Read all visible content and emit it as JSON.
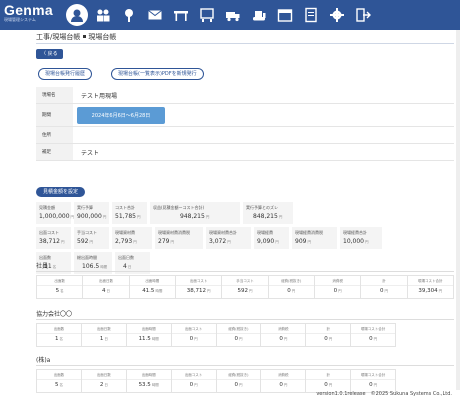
{
  "app": {
    "name": "Genma",
    "subtitle": "現場管理システム"
  },
  "nav": [
    "helmet-icon",
    "workers-icon",
    "location-pin-icon",
    "mail-icon",
    "trestle-icon",
    "site-board-icon",
    "truck-icon",
    "bulldozer-icon",
    "calendar-icon",
    "document-icon",
    "gear-icon",
    "exit-icon"
  ],
  "breadcrumb": {
    "parent": "工事/現場台帳",
    "current": "現場台帳"
  },
  "buttons": {
    "back": "〈 戻る",
    "history": "現場台帳発行履歴",
    "new_pdf": "現場台帳(一覧表示)PDFを新規発行",
    "budget": "見積金額を設定"
  },
  "form": {
    "site_name_label": "現場名",
    "site_name": "テスト用現場",
    "period_label": "期間",
    "period": "2024年6月6日〜6月28日",
    "address_label": "住所",
    "address": "",
    "note_label": "補足",
    "note": "テスト"
  },
  "summary": {
    "row1": [
      {
        "title": "見積金額",
        "value": "1,000,000",
        "unit": "円"
      },
      {
        "title": "実行予算",
        "value": "900,000",
        "unit": "円"
      },
      {
        "title": "コスト合計",
        "value": "51,785",
        "unit": "円"
      },
      {
        "title": "収益(見積金額ーコスト合計)",
        "value": "948,215",
        "unit": "円"
      },
      {
        "title": "実行予算とのズレ",
        "value": "848,215",
        "unit": "円"
      }
    ],
    "row2": [
      {
        "title": "出面コスト",
        "value": "38,712",
        "unit": "円"
      },
      {
        "title": "手当コスト",
        "value": "592",
        "unit": "円"
      },
      {
        "title": "現場資材費",
        "value": "2,793",
        "unit": "円"
      },
      {
        "title": "現場資材費消費税",
        "value": "279",
        "unit": "円"
      },
      {
        "title": "現場資材費合計",
        "value": "3,072",
        "unit": "円"
      },
      {
        "title": "現場経費",
        "value": "9,090",
        "unit": "円"
      },
      {
        "title": "現場経費消費税",
        "value": "909",
        "unit": "円"
      },
      {
        "title": "現場経費合計",
        "value": "10,000",
        "unit": "円"
      }
    ],
    "row3": [
      {
        "title": "出面数",
        "value": "11",
        "unit": "名"
      },
      {
        "title": "総出面時間",
        "value": "106.5",
        "unit": "時間"
      },
      {
        "title": "出面日数",
        "value": "4",
        "unit": "日"
      }
    ]
  },
  "sections": [
    {
      "title": "社員",
      "cols": [
        {
          "h": "出面数",
          "v": "5",
          "u": "名"
        },
        {
          "h": "出面日数",
          "v": "4",
          "u": "日"
        },
        {
          "h": "出面時間",
          "v": "41.5",
          "u": "時間"
        },
        {
          "h": "出面コスト",
          "v": "38,712",
          "u": "円"
        },
        {
          "h": "手当コスト",
          "v": "592",
          "u": "円"
        },
        {
          "h": "経費(税抜き)",
          "v": "0",
          "u": "円"
        },
        {
          "h": "消費税",
          "v": "0",
          "u": "円"
        },
        {
          "h": "計",
          "v": "0",
          "u": "円"
        },
        {
          "h": "現場コスト合計",
          "v": "39,304",
          "u": "円"
        }
      ]
    },
    {
      "title": "協力会社〇〇",
      "cols": [
        {
          "h": "出面数",
          "v": "1",
          "u": "名"
        },
        {
          "h": "出面日数",
          "v": "1",
          "u": "日"
        },
        {
          "h": "出面時間",
          "v": "11.5",
          "u": "時間"
        },
        {
          "h": "出面コスト",
          "v": "0",
          "u": "円"
        },
        {
          "h": "経費(税抜き)",
          "v": "0",
          "u": "円"
        },
        {
          "h": "消費税",
          "v": "0",
          "u": "円"
        },
        {
          "h": "計",
          "v": "0",
          "u": "円"
        },
        {
          "h": "現場コスト合計",
          "v": "0",
          "u": "円"
        }
      ]
    },
    {
      "title": "(株)a",
      "cols": [
        {
          "h": "出面数",
          "v": "5",
          "u": "名"
        },
        {
          "h": "出面日数",
          "v": "2",
          "u": "日"
        },
        {
          "h": "出面時間",
          "v": "53.5",
          "u": "時間"
        },
        {
          "h": "出面コスト",
          "v": "0",
          "u": "円"
        },
        {
          "h": "経費(税抜き)",
          "v": "0",
          "u": "円"
        },
        {
          "h": "消費税",
          "v": "0",
          "u": "円"
        },
        {
          "h": "計",
          "v": "0",
          "u": "円"
        },
        {
          "h": "現場コスト合計",
          "v": "0",
          "u": "円"
        }
      ]
    }
  ],
  "footer": "version1.0.1release　©2025 Sukuna Systems Co.,Ltd.",
  "colors": {
    "primary": "#2f5597",
    "accent": "#5b9bd5"
  }
}
